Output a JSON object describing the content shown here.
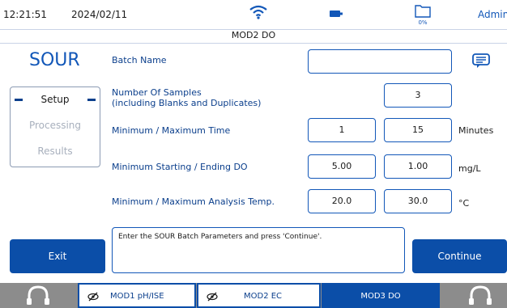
{
  "status_bar": {
    "time": "12:21:51",
    "date": "2024/02/11",
    "storage_percent": "0%",
    "user": "Admin"
  },
  "window_title": "MOD2 DO",
  "method_name": "SOUR",
  "side_menu": [
    {
      "label": "Setup",
      "state": "active"
    },
    {
      "label": "Processing",
      "state": "disabled"
    },
    {
      "label": "Results",
      "state": "disabled"
    }
  ],
  "form": {
    "batch_name": {
      "label": "Batch Name",
      "value": ""
    },
    "num_samples": {
      "label_line1": "Number Of Samples",
      "label_line2": "(including Blanks and Duplicates)",
      "value": "3"
    },
    "time": {
      "label": "Minimum / Maximum Time",
      "min": "1",
      "max": "15",
      "unit": "Minutes"
    },
    "do": {
      "label": "Minimum Starting / Ending DO",
      "min": "5.00",
      "max": "1.00",
      "unit": "mg/L"
    },
    "temp": {
      "label": "Minimum / Maximum Analysis Temp.",
      "min": "20.0",
      "max": "30.0",
      "unit": "°C"
    }
  },
  "message": "Enter the SOUR Batch Parameters and press 'Continue'.",
  "buttons": {
    "exit": "Exit",
    "continue": "Continue"
  },
  "module_tabs": [
    {
      "label": "MOD1 pH/ISE",
      "active": false
    },
    {
      "label": "MOD2 EC",
      "active": false
    },
    {
      "label": "MOD3 DO",
      "active": true
    }
  ],
  "colors": {
    "accent": "#0b4ea8",
    "text_blue": "#0b3f8c",
    "bottom_bar": "#8c8c8c"
  }
}
